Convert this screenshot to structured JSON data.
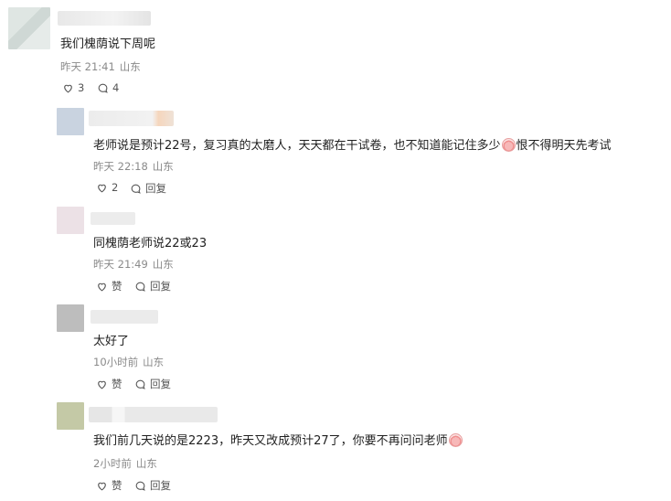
{
  "comments": [
    {
      "text": "我们槐荫说下周呢",
      "time": "昨天 21:41",
      "location": "山东",
      "like_label": "3",
      "reply_label": "4"
    },
    {
      "text_before_emoji": "老师说是预计22号，复习真的太磨人，天天都在干试卷，也不知道能记住多少",
      "text_after_emoji": "恨不得明天先考试",
      "time": "昨天 22:18",
      "location": "山东",
      "like_label": "2",
      "reply_label": "回复"
    },
    {
      "text": "同槐荫老师说22或23",
      "time": "昨天 21:49",
      "location": "山东",
      "like_label": "赞",
      "reply_label": "回复"
    },
    {
      "text": "太好了",
      "time": "10小时前",
      "location": "山东",
      "like_label": "赞",
      "reply_label": "回复"
    },
    {
      "text_before_emoji": "我们前几天说的是2223，昨天又改成预计27了，你要不再问问老师",
      "time": "2小时前",
      "location": "山东",
      "like_label": "赞",
      "reply_label": "回复"
    }
  ],
  "icons": {
    "like": "heart-outline-icon",
    "reply": "speech-bubble-icon",
    "emoji": "crying-face-emoji"
  }
}
